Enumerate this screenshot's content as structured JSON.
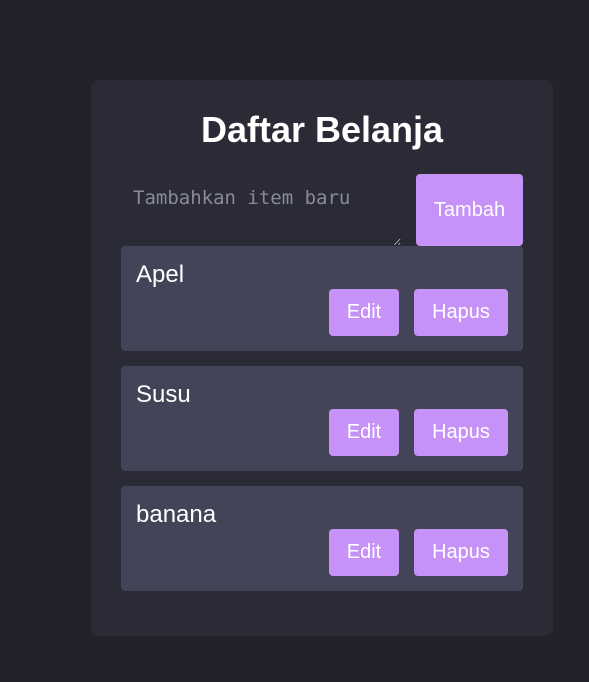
{
  "app": {
    "title": "Daftar Belanja"
  },
  "add_form": {
    "placeholder": "Tambahkan item baru",
    "value": "",
    "button_label": "Tambah"
  },
  "items": [
    {
      "label": "Apel",
      "edit_label": "Edit",
      "delete_label": "Hapus"
    },
    {
      "label": "Susu",
      "edit_label": "Edit",
      "delete_label": "Hapus"
    },
    {
      "label": "banana",
      "edit_label": "Edit",
      "delete_label": "Hapus"
    }
  ],
  "colors": {
    "page_background": "#22222b",
    "card_background": "#2a2b37",
    "item_background": "#434457",
    "accent": "#c792f8",
    "text": "#ffffff"
  }
}
